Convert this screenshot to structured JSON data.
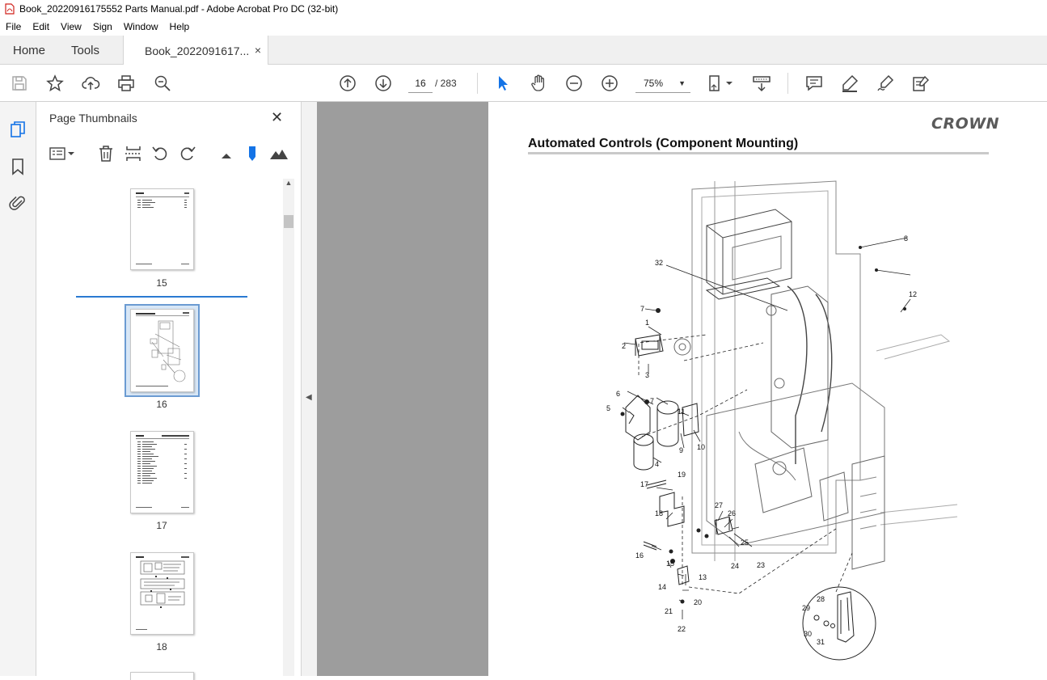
{
  "window": {
    "title": "Book_20220916175552 Parts Manual.pdf - Adobe Acrobat Pro DC (32-bit)"
  },
  "menu": {
    "items": [
      "File",
      "Edit",
      "View",
      "Sign",
      "Window",
      "Help"
    ]
  },
  "tabs": {
    "home": "Home",
    "tools": "Tools",
    "document": "Book_2022091617...",
    "close": "×"
  },
  "toolbar": {
    "current_page": "16",
    "total_pages": "/ 283",
    "zoom": "75%"
  },
  "thumbnails": {
    "title": "Page Thumbnails",
    "close": "✕",
    "pages": [
      {
        "label": "15"
      },
      {
        "label": "16"
      },
      {
        "label": "17"
      },
      {
        "label": "18"
      }
    ]
  },
  "document": {
    "brand": "CROWN",
    "title": "Automated Controls (Component Mounting)",
    "callouts": [
      "32",
      "8",
      "7",
      "12",
      "1",
      "2",
      "3",
      "6",
      "7",
      "5",
      "11",
      "9",
      "10",
      "4",
      "19",
      "17",
      "18",
      "27",
      "26",
      "25",
      "24",
      "23",
      "16",
      "15",
      "13",
      "14",
      "20",
      "21",
      "22",
      "28",
      "29",
      "30",
      "31"
    ]
  },
  "colors": {
    "accent": "#2a7ad2",
    "canvas": "#9d9d9d",
    "pointer": "#1473e6"
  }
}
